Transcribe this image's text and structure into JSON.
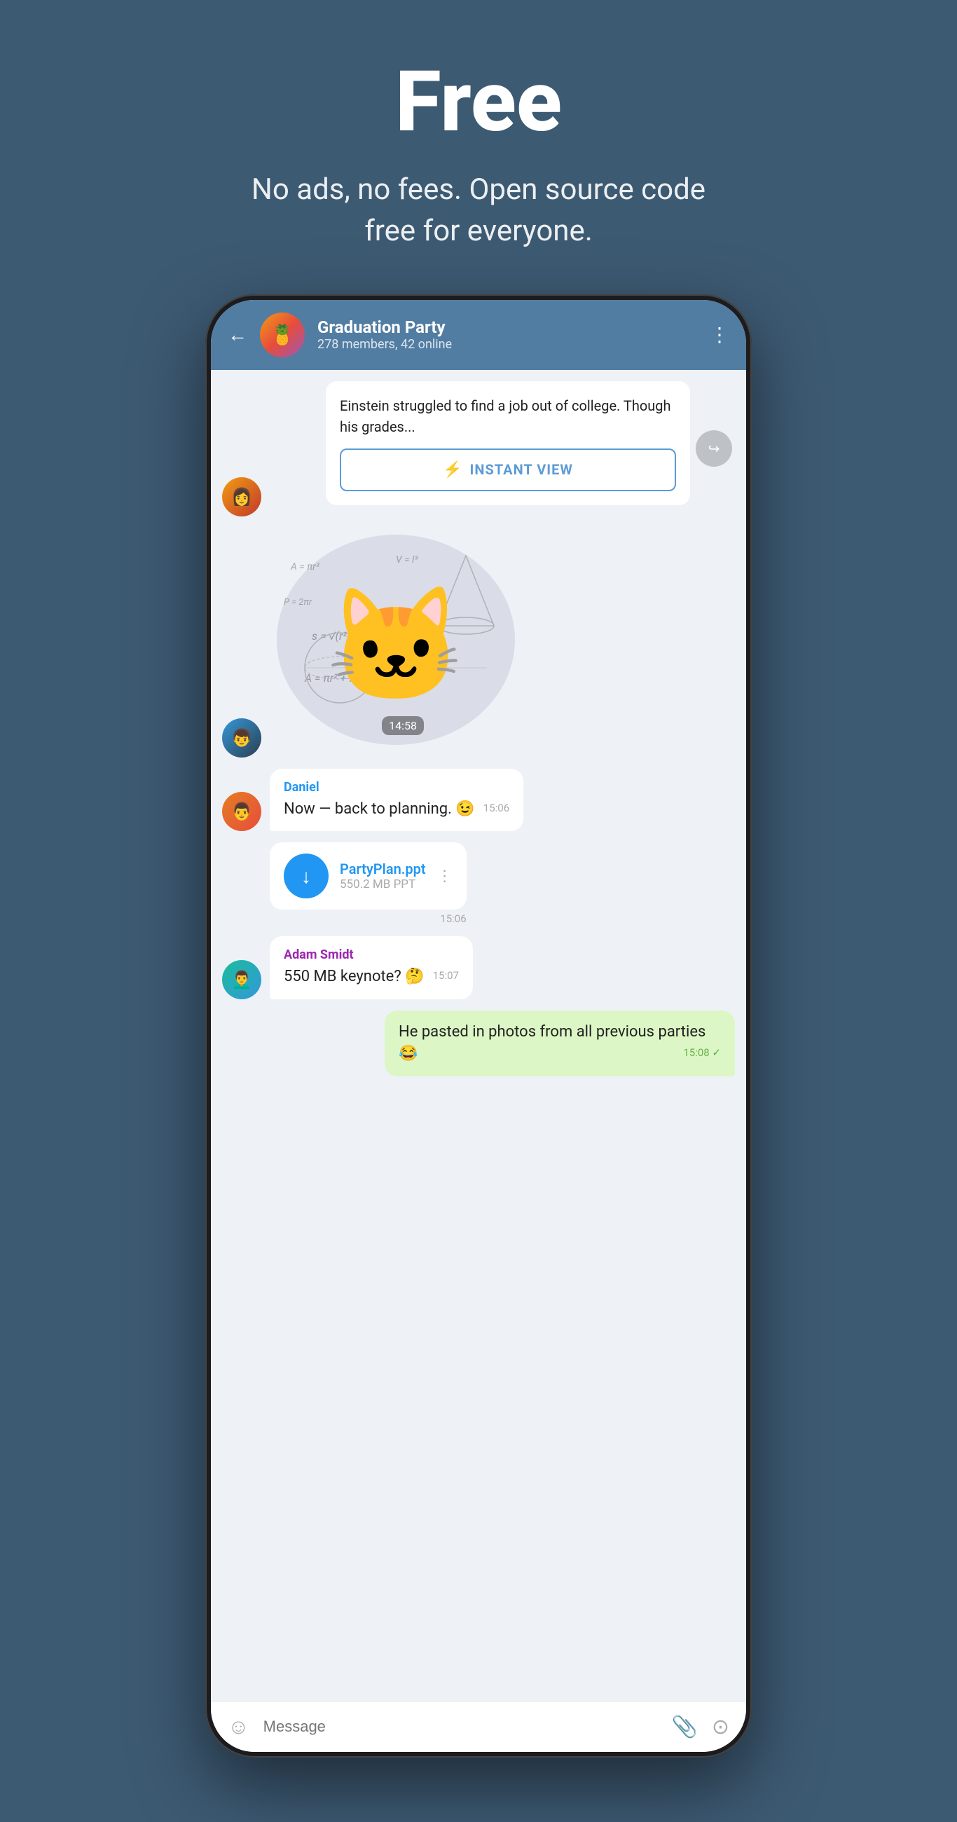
{
  "hero": {
    "title": "Free",
    "subtitle": "No ads, no fees. Open source code free for everyone."
  },
  "header": {
    "back_label": "←",
    "chat_name": "Graduation Party",
    "chat_members": "278 members, 42 online",
    "more_icon": "⋮"
  },
  "messages": [
    {
      "type": "article",
      "text": "Einstein struggled to find a job out of college. Though his grades...",
      "instant_view_label": "INSTANT VIEW",
      "bolt": "⚡"
    },
    {
      "type": "sticker",
      "timestamp": "14:58"
    },
    {
      "type": "text",
      "sender": "Daniel",
      "text": "Now — back to planning. 😉",
      "time": "15:06"
    },
    {
      "type": "file",
      "sender": "Daniel",
      "file_name": "PartyPlan.ppt",
      "file_meta": "550.2 MB PPT",
      "time": "15:06",
      "more": "⋮",
      "download_icon": "↓"
    },
    {
      "type": "text",
      "sender": "Adam Smidt",
      "text": "550 MB keynote? 🤔",
      "time": "15:07"
    },
    {
      "type": "self",
      "text": "He pasted in photos from all previous parties 😂",
      "time": "15:08",
      "status": "✓"
    }
  ],
  "input_bar": {
    "placeholder": "Message",
    "emoji_icon": "☺",
    "attach_icon": "📎",
    "camera_icon": "⊙"
  }
}
